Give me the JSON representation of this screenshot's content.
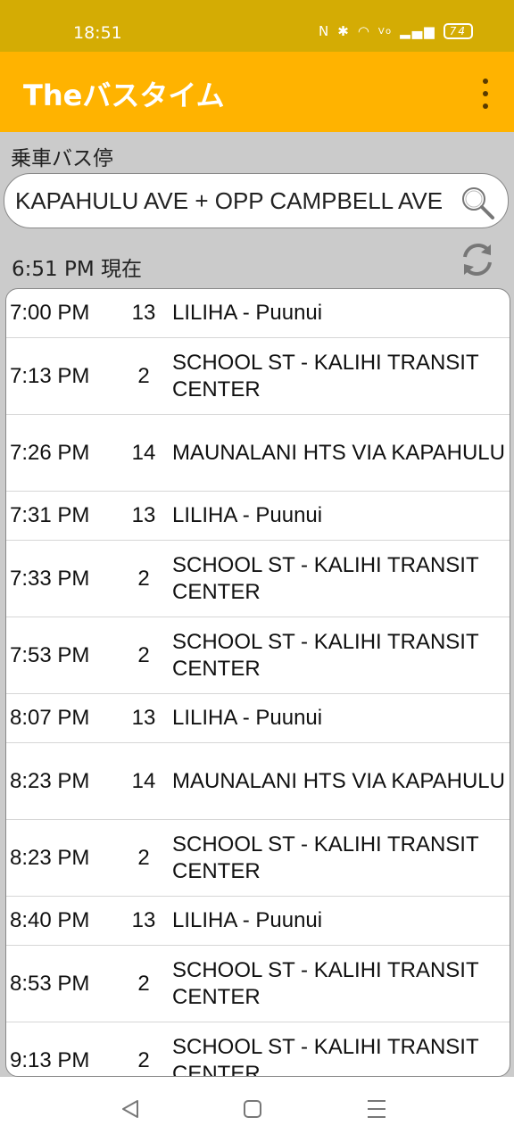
{
  "status_bar": {
    "time": "18:51",
    "icons": [
      "nfc-icon",
      "bluetooth-icon",
      "wifi-icon",
      "volte-icon",
      "signal-icon"
    ],
    "battery": "74"
  },
  "app_bar": {
    "title": "Theバスタイム"
  },
  "stop_label": "乗車バス停",
  "search": {
    "value": "KAPAHULU AVE + OPP CAMPBELL AVE"
  },
  "current": {
    "time": "6:51 PM",
    "suffix": "現在"
  },
  "arrivals": [
    {
      "time": "7:00 PM",
      "route": "13",
      "destination": "LILIHA - Puunui"
    },
    {
      "time": "7:13 PM",
      "route": "2",
      "destination": "SCHOOL ST - KALIHI TRANSIT CENTER"
    },
    {
      "time": "7:26 PM",
      "route": "14",
      "destination": "MAUNALANI HTS VIA KAPAHULU"
    },
    {
      "time": "7:31 PM",
      "route": "13",
      "destination": "LILIHA - Puunui"
    },
    {
      "time": "7:33 PM",
      "route": "2",
      "destination": "SCHOOL ST - KALIHI TRANSIT CENTER"
    },
    {
      "time": "7:53 PM",
      "route": "2",
      "destination": "SCHOOL ST - KALIHI TRANSIT CENTER"
    },
    {
      "time": "8:07 PM",
      "route": "13",
      "destination": "LILIHA - Puunui"
    },
    {
      "time": "8:23 PM",
      "route": "14",
      "destination": "MAUNALANI HTS VIA KAPAHULU"
    },
    {
      "time": "8:23 PM",
      "route": "2",
      "destination": "SCHOOL ST - KALIHI TRANSIT CENTER"
    },
    {
      "time": "8:40 PM",
      "route": "13",
      "destination": "LILIHA - Puunui"
    },
    {
      "time": "8:53 PM",
      "route": "2",
      "destination": "SCHOOL ST - KALIHI TRANSIT CENTER"
    },
    {
      "time": "9:13 PM",
      "route": "2",
      "destination": "SCHOOL ST - KALIHI TRANSIT CENTER"
    }
  ],
  "nav_bar": {
    "buttons": [
      "back-icon",
      "home-icon",
      "recents-icon"
    ]
  },
  "colors": {
    "status_bar": "#d4ac04",
    "app_bar": "#ffb300",
    "background": "#cbcbcb"
  }
}
